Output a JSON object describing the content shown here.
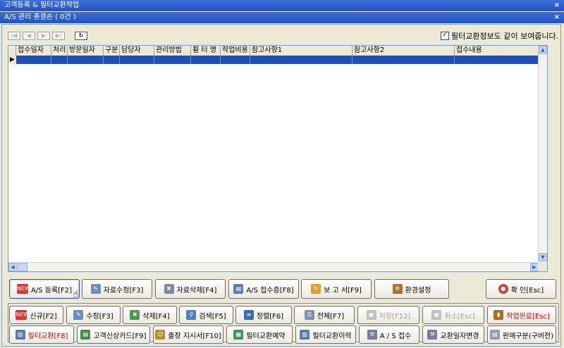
{
  "window_title": "고객등록 & 필터교환작업",
  "subwindow_title": "A/S 관리 총결손 ( 0건 )",
  "close_glyph": "×",
  "checkbox_label": "필터교환정보도 같이 보여줍니다.",
  "columns": [
    "접수일자",
    "처리",
    "방문일자",
    "구분",
    "담당자",
    "관리방법",
    "휠 터 명",
    "작업비용",
    "참고사항1",
    "참고사항2",
    "접수내용"
  ],
  "action_buttons": {
    "as_register": "A/S 등록[F2]",
    "edit_data": "자료수정[F3]",
    "delete_data": "자료삭제[F4]",
    "as_receipt": "A/S 접수증[F8]",
    "report": "보 고 서[F9]",
    "settings": "환경설정",
    "confirm": "확 인[Esc]"
  },
  "bottom_row1": {
    "new": "신규[F2]",
    "edit": "수정[F3]",
    "delete": "삭제[F4]",
    "search": "검색[F5]",
    "sort": "정렬[F6]",
    "all": "전체[F7]",
    "save": "저장[F12]",
    "cancel": "취소[Esc]",
    "done": "작업완료[Esc]"
  },
  "bottom_row2": {
    "filter_exchange": "필터교환[F8]",
    "customer_card": "고객신상카드[F9]",
    "dispatch": "출장 지시서[F10]",
    "filter_reserve": "필터교환예약",
    "filter_history": "필터교환이력",
    "as_accept": "A / S 접수",
    "change_date": "교환일자변경",
    "sales_type": "판매구분(구버전)"
  },
  "new_badge": "NEW",
  "colors": {
    "title_bar": "#2353c4",
    "selected_row": "#1e4fb8",
    "red_text": "#d40000"
  }
}
